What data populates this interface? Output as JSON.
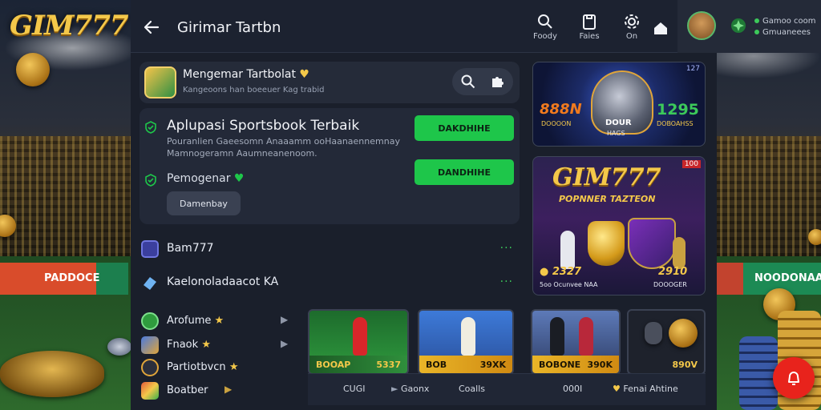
{
  "brand": {
    "logo_text": "GIM777"
  },
  "stadium": {
    "board_left": "PADDOCE",
    "board_right": "NOODONAA"
  },
  "topbar": {
    "title": "Girimar Tartbn",
    "actions": [
      {
        "label": "Foody",
        "icon": "search-icon"
      },
      {
        "label": "Faies",
        "icon": "clipboard-icon"
      },
      {
        "label": "On",
        "icon": "settings-icon"
      },
      {
        "label": "",
        "icon": "home-icon"
      }
    ],
    "user": {
      "line1": "Gamoo coom",
      "line2": "Gmuaneees"
    }
  },
  "header_card": {
    "title": "Mengemar Tartbolat",
    "subtitle": "Kangeoons han boeeuer Kag trabid"
  },
  "feature_card": {
    "title": "Aplupasi Sportsbook Terbaik",
    "description": "Pouranlien Gaeesomn Anaaamm ooHaanaennemnay Mamnogeramn Aaumneanenoom.",
    "button1": "DAKDHIHE",
    "button2": "DANDHIHE",
    "label": "Pemogenar",
    "pill": "Damenbay"
  },
  "list_rows": [
    {
      "label": "Bam777",
      "more": "..."
    },
    {
      "label": "Kaelonoladaacot KA",
      "more": "..."
    }
  ],
  "side_items": [
    {
      "label": "Arofume"
    },
    {
      "label": "Fnaok"
    },
    {
      "label": "Partiotbvcn"
    },
    {
      "label": "Boatber"
    }
  ],
  "tiles": [
    {
      "left": "BOOAP",
      "right": "5337"
    },
    {
      "left": "BOB",
      "right": "39XK"
    },
    {
      "left": "BOBONE",
      "right": "390K"
    },
    {
      "left": "",
      "right": "890V"
    }
  ],
  "tabs": [
    "CUGI",
    "Gaonx",
    "Coalls",
    "000I",
    "Fenai Ahtine"
  ],
  "promos": {
    "p1_tag": "127",
    "p1_left_num": "888N",
    "p1_left_sub": "DOOOON",
    "p1_center": "DOUR",
    "p1_center_sub": "HAGS",
    "p1_right_num": "1295",
    "p1_right_sub": "DOBOAHSS",
    "p2_tag": "100",
    "p2_title": "GIM777",
    "p2_subtitle": "POPNNER TAZTEON",
    "p2_left_num": "2327",
    "p2_left_sub": "5oo Ocunvee NAA",
    "p2_right_num": "2910",
    "p2_right_sub": "DOOOGER"
  },
  "colors": {
    "accent_green": "#1ec64a",
    "accent_gold": "#f4c84a",
    "fab_red": "#e8231c"
  }
}
